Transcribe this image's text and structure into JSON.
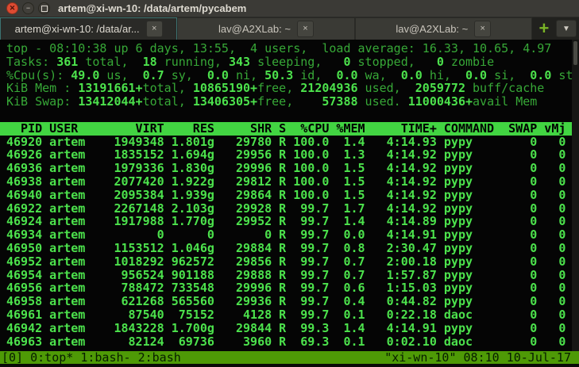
{
  "window": {
    "title": "artem@xi-wn-10: /data/artem/pycabem"
  },
  "icons": {
    "close": "✕",
    "minimize": "−",
    "tab_close": "×",
    "new_tab": "+",
    "menu_arrow": "▼"
  },
  "tabbar": {
    "tabs": [
      {
        "label": "artem@xi-wn-10: /data/ar...",
        "active": true
      },
      {
        "label": "lav@A2XLab: ~",
        "active": false
      },
      {
        "label": "lav@A2XLab: ~",
        "active": false
      }
    ]
  },
  "terminal": {
    "summary": [
      [
        {
          "t": "top - 08:10:38 up 6 days, 13:55,  4 users,  load average: 16.33, 10.65, 4.97"
        }
      ],
      [
        {
          "t": "Tasks: "
        },
        {
          "t": "361",
          "b": true
        },
        {
          "t": " total,  "
        },
        {
          "t": "18",
          "b": true
        },
        {
          "t": " running, "
        },
        {
          "t": "343",
          "b": true
        },
        {
          "t": " sleeping,   "
        },
        {
          "t": "0",
          "b": true
        },
        {
          "t": " stopped,   "
        },
        {
          "t": "0",
          "b": true
        },
        {
          "t": " zombie"
        }
      ],
      [
        {
          "t": "%Cpu(s): "
        },
        {
          "t": "49.0",
          "b": true
        },
        {
          "t": " us,  "
        },
        {
          "t": "0.7",
          "b": true
        },
        {
          "t": " sy,  "
        },
        {
          "t": "0.0",
          "b": true
        },
        {
          "t": " ni, "
        },
        {
          "t": "50.3",
          "b": true
        },
        {
          "t": " id,  "
        },
        {
          "t": "0.0",
          "b": true
        },
        {
          "t": " wa,  "
        },
        {
          "t": "0.0",
          "b": true
        },
        {
          "t": " hi,  "
        },
        {
          "t": "0.0",
          "b": true
        },
        {
          "t": " si,  "
        },
        {
          "t": "0.0",
          "b": true
        },
        {
          "t": " st"
        }
      ],
      [
        {
          "t": "KiB Mem : "
        },
        {
          "t": "13191661+",
          "b": true
        },
        {
          "t": "total, "
        },
        {
          "t": "10865190+",
          "b": true
        },
        {
          "t": "free, "
        },
        {
          "t": "21204936",
          "b": true
        },
        {
          "t": " used,  "
        },
        {
          "t": "2059772",
          "b": true
        },
        {
          "t": " buff/cache"
        }
      ],
      [
        {
          "t": "KiB Swap: "
        },
        {
          "t": "13412044+",
          "b": true
        },
        {
          "t": "total, "
        },
        {
          "t": "13406305+",
          "b": true
        },
        {
          "t": "free,    "
        },
        {
          "t": "57388",
          "b": true
        },
        {
          "t": " used. "
        },
        {
          "t": "11000436+",
          "b": true
        },
        {
          "t": "avail Mem"
        }
      ]
    ],
    "columns": [
      "PID",
      "USER",
      "VIRT",
      "RES",
      "SHR",
      "S",
      "%CPU",
      "%MEM",
      "TIME+",
      "COMMAND",
      "SWAP",
      "vMj"
    ],
    "processes": [
      {
        "pid": "46920",
        "user": "artem",
        "virt": "1949348",
        "res": "1.801g",
        "shr": "29780",
        "s": "R",
        "cpu": "100.0",
        "mem": "1.4",
        "time": "4:14.93",
        "cmd": "pypy",
        "swap": "0",
        "vmj": "0"
      },
      {
        "pid": "46926",
        "user": "artem",
        "virt": "1835152",
        "res": "1.694g",
        "shr": "29956",
        "s": "R",
        "cpu": "100.0",
        "mem": "1.3",
        "time": "4:14.92",
        "cmd": "pypy",
        "swap": "0",
        "vmj": "0"
      },
      {
        "pid": "46936",
        "user": "artem",
        "virt": "1979336",
        "res": "1.830g",
        "shr": "29996",
        "s": "R",
        "cpu": "100.0",
        "mem": "1.5",
        "time": "4:14.92",
        "cmd": "pypy",
        "swap": "0",
        "vmj": "0"
      },
      {
        "pid": "46938",
        "user": "artem",
        "virt": "2077420",
        "res": "1.922g",
        "shr": "29812",
        "s": "R",
        "cpu": "100.0",
        "mem": "1.5",
        "time": "4:14.92",
        "cmd": "pypy",
        "swap": "0",
        "vmj": "0"
      },
      {
        "pid": "46940",
        "user": "artem",
        "virt": "2095384",
        "res": "1.939g",
        "shr": "29864",
        "s": "R",
        "cpu": "100.0",
        "mem": "1.5",
        "time": "4:14.92",
        "cmd": "pypy",
        "swap": "0",
        "vmj": "0"
      },
      {
        "pid": "46922",
        "user": "artem",
        "virt": "2267148",
        "res": "2.103g",
        "shr": "29928",
        "s": "R",
        "cpu": "99.7",
        "mem": "1.7",
        "time": "4:14.92",
        "cmd": "pypy",
        "swap": "0",
        "vmj": "0"
      },
      {
        "pid": "46924",
        "user": "artem",
        "virt": "1917988",
        "res": "1.770g",
        "shr": "29952",
        "s": "R",
        "cpu": "99.7",
        "mem": "1.4",
        "time": "4:14.89",
        "cmd": "pypy",
        "swap": "0",
        "vmj": "0"
      },
      {
        "pid": "46934",
        "user": "artem",
        "virt": "0",
        "res": "0",
        "shr": "0",
        "s": "R",
        "cpu": "99.7",
        "mem": "0.0",
        "time": "4:14.91",
        "cmd": "pypy",
        "swap": "0",
        "vmj": "0"
      },
      {
        "pid": "46950",
        "user": "artem",
        "virt": "1153512",
        "res": "1.046g",
        "shr": "29884",
        "s": "R",
        "cpu": "99.7",
        "mem": "0.8",
        "time": "2:30.47",
        "cmd": "pypy",
        "swap": "0",
        "vmj": "0"
      },
      {
        "pid": "46952",
        "user": "artem",
        "virt": "1018292",
        "res": "962572",
        "shr": "29856",
        "s": "R",
        "cpu": "99.7",
        "mem": "0.7",
        "time": "2:00.18",
        "cmd": "pypy",
        "swap": "0",
        "vmj": "0"
      },
      {
        "pid": "46954",
        "user": "artem",
        "virt": "956524",
        "res": "901188",
        "shr": "29888",
        "s": "R",
        "cpu": "99.7",
        "mem": "0.7",
        "time": "1:57.87",
        "cmd": "pypy",
        "swap": "0",
        "vmj": "0"
      },
      {
        "pid": "46956",
        "user": "artem",
        "virt": "788472",
        "res": "733548",
        "shr": "29996",
        "s": "R",
        "cpu": "99.7",
        "mem": "0.6",
        "time": "1:15.03",
        "cmd": "pypy",
        "swap": "0",
        "vmj": "0"
      },
      {
        "pid": "46958",
        "user": "artem",
        "virt": "621268",
        "res": "565560",
        "shr": "29936",
        "s": "R",
        "cpu": "99.7",
        "mem": "0.4",
        "time": "0:44.82",
        "cmd": "pypy",
        "swap": "0",
        "vmj": "0"
      },
      {
        "pid": "46961",
        "user": "artem",
        "virt": "87540",
        "res": "75152",
        "shr": "4128",
        "s": "R",
        "cpu": "99.7",
        "mem": "0.1",
        "time": "0:22.18",
        "cmd": "daoc",
        "swap": "0",
        "vmj": "0"
      },
      {
        "pid": "46942",
        "user": "artem",
        "virt": "1843228",
        "res": "1.700g",
        "shr": "29844",
        "s": "R",
        "cpu": "99.3",
        "mem": "1.4",
        "time": "4:14.91",
        "cmd": "pypy",
        "swap": "0",
        "vmj": "0"
      },
      {
        "pid": "46963",
        "user": "artem",
        "virt": "82124",
        "res": "69736",
        "shr": "3960",
        "s": "R",
        "cpu": "69.3",
        "mem": "0.1",
        "time": "0:02.10",
        "cmd": "daoc",
        "swap": "0",
        "vmj": "0"
      }
    ]
  },
  "statusbar": {
    "left": "[0] 0:top* 1:bash- 2:bash",
    "right": "\"xi-wn-10\" 08:10 10-Jul-17"
  },
  "colors": {
    "term_bg": "#050505",
    "green": "#37a837",
    "green_bright": "#4ce24c",
    "header_bg": "#42d542",
    "status_bg": "#4e9a06",
    "titlebar_bg": "#3b3a36",
    "close_btn": "#dd4b32",
    "new_tab_green": "#7ab427",
    "active_tab_border": "#3c7371"
  }
}
